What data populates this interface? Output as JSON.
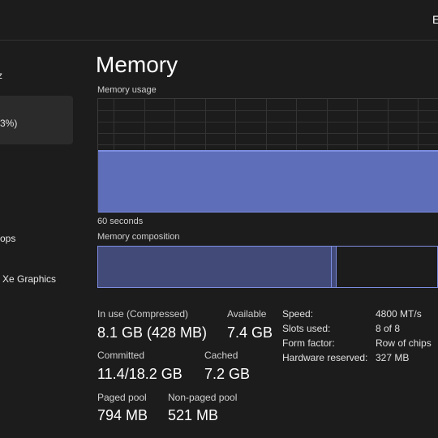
{
  "header": {
    "partial_button": "E"
  },
  "sidebar": {
    "items": [
      {
        "label": "z"
      },
      {
        "label": "3%)",
        "selected": true
      },
      {
        "label": "ops"
      },
      {
        "label": "Xe Graphics"
      }
    ]
  },
  "page": {
    "title": "Memory"
  },
  "usage_graph": {
    "label": "Memory usage",
    "time_label": "60 seconds",
    "usage_percent": 53,
    "color": "#5f6eb8"
  },
  "composition": {
    "label": "Memory composition",
    "in_use_fraction": 0.686,
    "modified_fraction": 0.012,
    "color": "#424a78"
  },
  "stats": {
    "in_use": {
      "label": "In use (Compressed)",
      "value": "8.1 GB (428 MB)"
    },
    "available": {
      "label": "Available",
      "value": "7.4 GB"
    },
    "committed": {
      "label": "Committed",
      "value": "11.4/18.2 GB"
    },
    "cached": {
      "label": "Cached",
      "value": "7.2 GB"
    },
    "paged_pool": {
      "label": "Paged pool",
      "value": "794 MB"
    },
    "non_paged_pool": {
      "label": "Non-paged pool",
      "value": "521 MB"
    }
  },
  "details": [
    {
      "key": "Speed:",
      "value": "4800 MT/s"
    },
    {
      "key": "Slots used:",
      "value": "8 of 8"
    },
    {
      "key": "Form factor:",
      "value": "Row of chips"
    },
    {
      "key": "Hardware reserved:",
      "value": "327 MB"
    }
  ]
}
